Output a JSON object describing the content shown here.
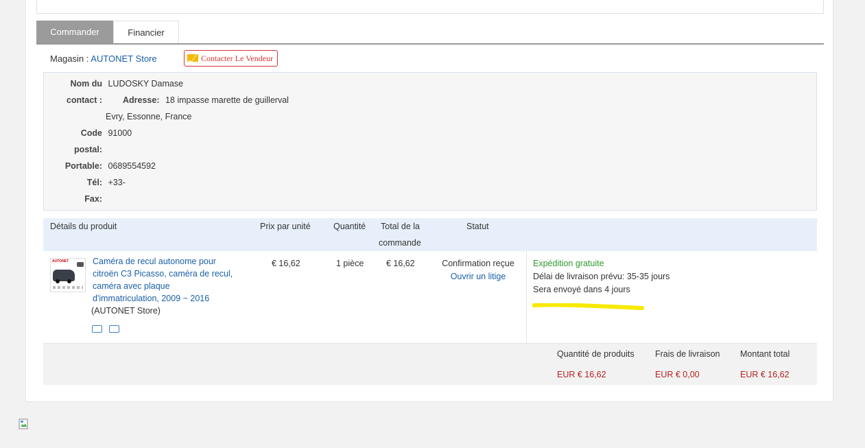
{
  "tabs": [
    {
      "label": "Commander"
    },
    {
      "label": "Financier"
    }
  ],
  "store": {
    "label": "Magasin :",
    "name": "AUTONET Store",
    "contact_button": "Contacter Le Vendeur"
  },
  "address": {
    "name_key_1": "Nom du",
    "name_key_2": "contact :",
    "name_value": "LUDOSKY Damase",
    "address_key": "Adresse:",
    "address_line1": "18 impasse marette de guillerval",
    "address_line2": "Evry, Essonne, France",
    "postal_key_1": "Code",
    "postal_key_2": "postal:",
    "postal_value": "91000",
    "mobile_key": "Portable:",
    "mobile_value": "0689554592",
    "phone_key": "Tél:",
    "phone_value": "+33-",
    "fax_key": "Fax:",
    "fax_value": ""
  },
  "table": {
    "headers": {
      "product": "Détails du produit",
      "unit_price": "Prix par unité",
      "quantity": "Quantité",
      "total_1": "Total de la",
      "total_2": "commande",
      "status": "Statut"
    },
    "row": {
      "title_lines": [
        "Caméra de recul autonome pour",
        "citroën C3 Picasso, caméra de recul,",
        "caméra avec plaque",
        "d'immatriculation, 2009 ~ 2016"
      ],
      "store": "(AUTONET Store)",
      "thumb_brand": "AUTONET",
      "unit_price": "€ 16,62",
      "quantity": "1 pièce",
      "total": "€ 16,62",
      "status": "Confirmation reçue",
      "dispute_link": "Ouvrir un litige",
      "shipping_free": "Expédition gratuite",
      "delivery_label": "Délai de livraison prévu:",
      "delivery_value": "35-35 jours",
      "ship_label": "Sera envoyé dans",
      "ship_value": "4 jours"
    }
  },
  "summary": {
    "products_qty_label": "Quantité de produits",
    "shipping_fee_label": "Frais de livraison",
    "total_label": "Montant total",
    "products_value": "EUR € 16,62",
    "shipping_value": "EUR € 0,00",
    "total_value": "EUR € 16,62"
  },
  "colors": {
    "link": "#1a5fa8",
    "price": "#b22222",
    "green": "#2e9a2e",
    "highlight": "#f7ea00",
    "contact": "#dd3333"
  },
  "icons": [
    "envelope-icon",
    "truck-icon",
    "card-icon",
    "broken-image-icon"
  ]
}
